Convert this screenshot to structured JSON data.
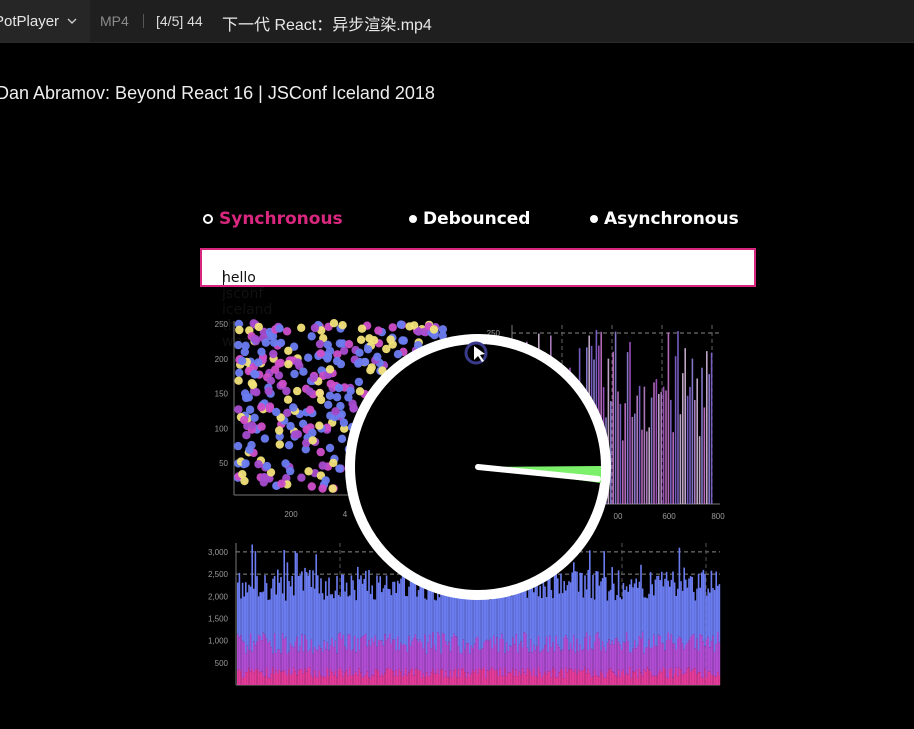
{
  "titlebar": {
    "app_name": "PotPlayer",
    "format": "MP4",
    "playlist_position": "[4/5] 44",
    "file_name": "下一代 React：异步渲染.mp4"
  },
  "video": {
    "title": "Dan Abramov: Beyond React 16 | JSConf Iceland 2018",
    "modes": [
      {
        "label": "Synchronous",
        "selected": true,
        "color": "#d9277f"
      },
      {
        "label": "Debounced",
        "selected": false,
        "color": "#ffffff"
      },
      {
        "label": "Asynchronous",
        "selected": false,
        "color": "#ffffff"
      }
    ],
    "input_value": "hello jsconf iceland the weath"
  },
  "colors": {
    "accent": "#d9277f",
    "blue": "#6b7cf0",
    "yellow": "#f2e37a",
    "purple": "#a64ccf",
    "green": "#7cf06b"
  },
  "chart_data": [
    {
      "type": "scatter",
      "yticks": [
        "250",
        "200",
        "150",
        "100",
        "50"
      ],
      "xticks": [
        "200",
        "4"
      ],
      "ylim": [
        0,
        250
      ]
    },
    {
      "type": "bar",
      "yticks": [
        "250"
      ],
      "xticks": [
        "00",
        "600",
        "800"
      ],
      "ylim": [
        0,
        250
      ]
    },
    {
      "type": "area",
      "yticks": [
        "3,000",
        "2,500",
        "2,000",
        "1,500",
        "1,000",
        "500"
      ],
      "ylim": [
        0,
        3200
      ]
    }
  ],
  "timer": {
    "icon": "clock-indicator-icon",
    "sweep_color": "#7cf06b"
  }
}
